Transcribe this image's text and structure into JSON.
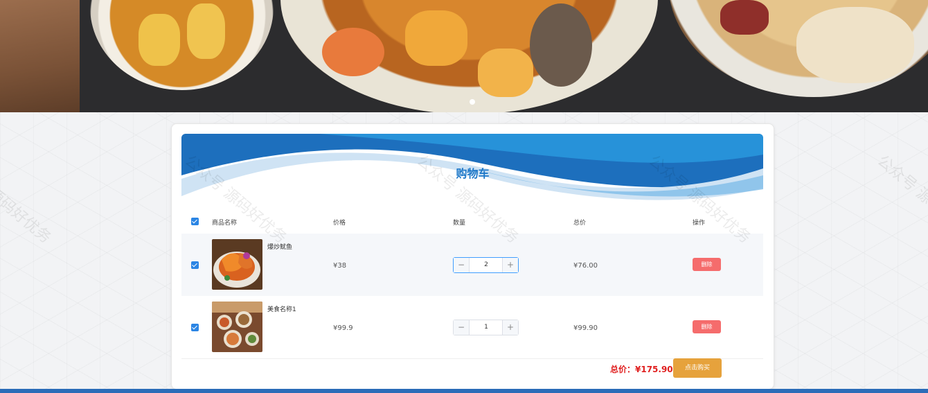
{
  "cart": {
    "title": "购物车",
    "headers": {
      "name": "商品名称",
      "price": "价格",
      "quantity": "数量",
      "total": "总价",
      "action": "操作"
    },
    "items": [
      {
        "name": "爆炒鱿鱼",
        "price": "¥38",
        "quantity": "2",
        "subtotal": "¥76.00",
        "delete_label": "删除",
        "checked": true
      },
      {
        "name": "美食名称1",
        "price": "¥99.9",
        "quantity": "1",
        "subtotal": "¥99.90",
        "delete_label": "删除",
        "checked": true
      }
    ],
    "total_label": "总价：¥175.90",
    "buy_label": "点击购买"
  },
  "watermark": "公众号 源码好优务",
  "colors": {
    "accent": "#1e78c8",
    "checkbox": "#2b85e4",
    "delete": "#f56c6c",
    "buy": "#e6a23c",
    "total": "#e02020"
  }
}
